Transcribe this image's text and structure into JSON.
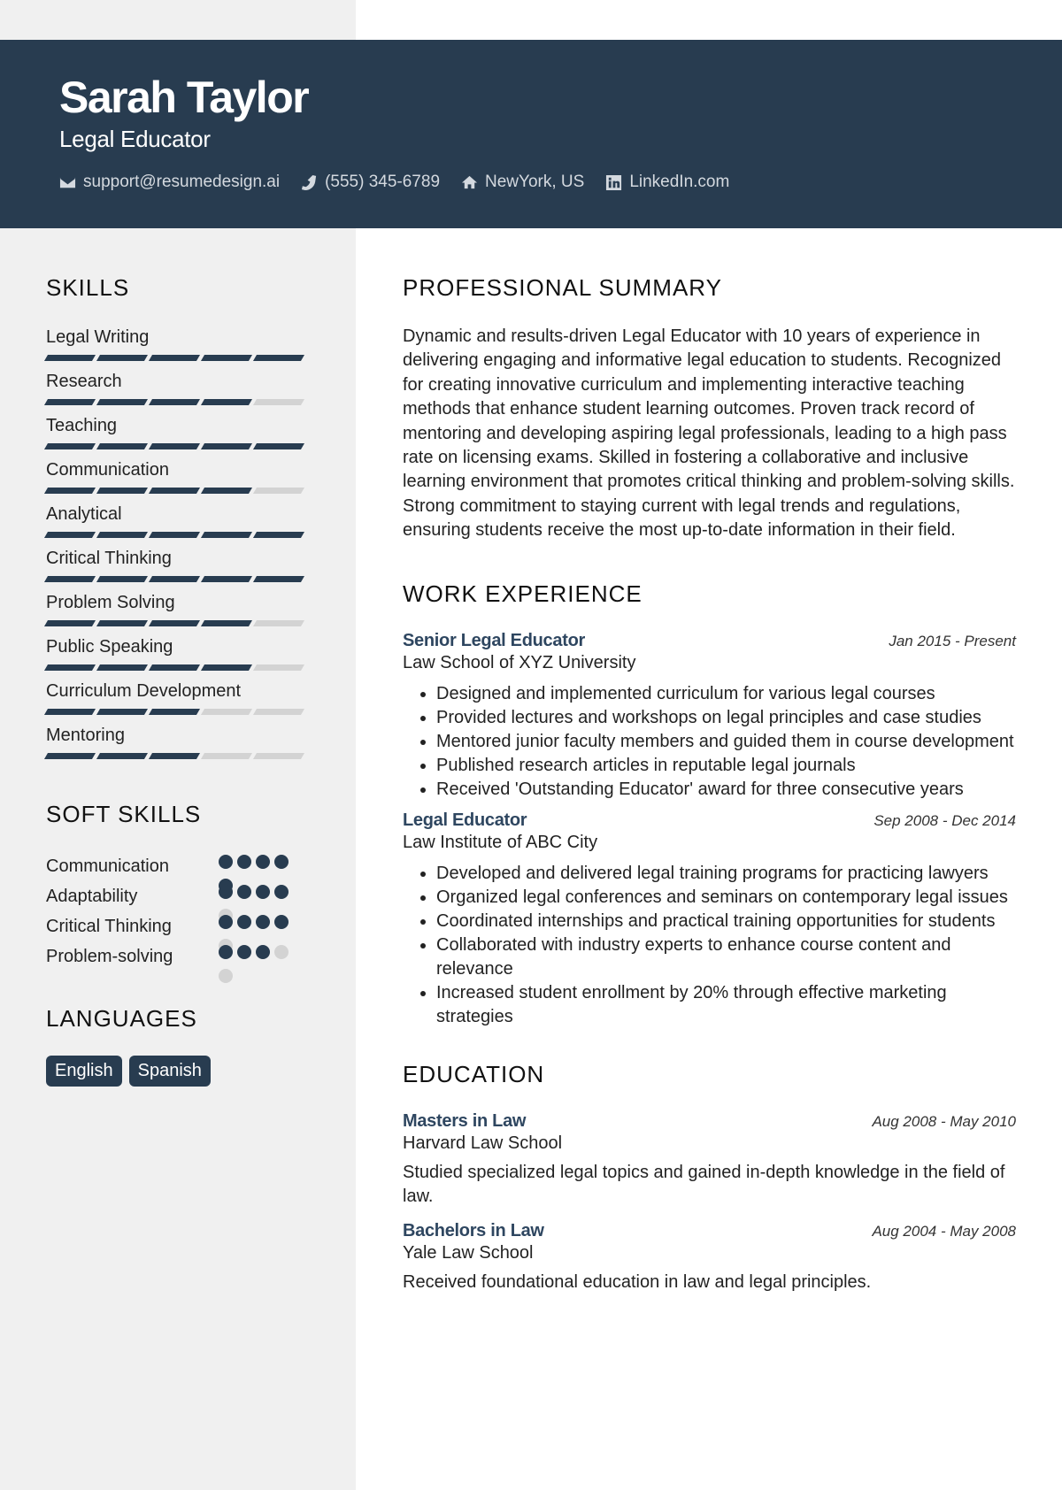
{
  "header": {
    "name": "Sarah Taylor",
    "role": "Legal Educator",
    "contacts": [
      {
        "icon": "envelope-icon",
        "text": "support@resumedesign.ai"
      },
      {
        "icon": "phone-icon",
        "text": "(555) 345-6789"
      },
      {
        "icon": "home-icon",
        "text": "NewYork, US"
      },
      {
        "icon": "linkedin-icon",
        "text": "LinkedIn.com"
      }
    ]
  },
  "colors": {
    "accent": "#283c50",
    "sidebar_bg": "#f0f0f0",
    "inactive": "#d3d3d3"
  },
  "sidebar": {
    "skills_heading": "SKILLS",
    "skills": [
      {
        "name": "Legal Writing",
        "level": 5,
        "max": 5
      },
      {
        "name": "Research",
        "level": 4,
        "max": 5
      },
      {
        "name": "Teaching",
        "level": 5,
        "max": 5
      },
      {
        "name": "Communication",
        "level": 4,
        "max": 5
      },
      {
        "name": "Analytical",
        "level": 5,
        "max": 5
      },
      {
        "name": "Critical Thinking",
        "level": 5,
        "max": 5
      },
      {
        "name": "Problem Solving",
        "level": 4,
        "max": 5
      },
      {
        "name": "Public Speaking",
        "level": 4,
        "max": 5
      },
      {
        "name": "Curriculum Development",
        "level": 3,
        "max": 5
      },
      {
        "name": "Mentoring",
        "level": 3,
        "max": 5
      }
    ],
    "soft_skills_heading": "SOFT SKILLS",
    "soft_skills": [
      {
        "name": "Communication",
        "level": 5,
        "max": 5
      },
      {
        "name": "Adaptability",
        "level": 4,
        "max": 5
      },
      {
        "name": "Critical Thinking",
        "level": 4,
        "max": 5
      },
      {
        "name": "Problem-solving",
        "level": 3,
        "max": 5
      }
    ],
    "languages_heading": "LANGUAGES",
    "languages": [
      "English",
      "Spanish"
    ]
  },
  "main": {
    "summary_heading": "PROFESSIONAL SUMMARY",
    "summary": "Dynamic and results-driven Legal Educator with 10 years of experience in delivering engaging and informative legal education to students. Recognized for creating innovative curriculum and implementing interactive teaching methods that enhance student learning outcomes. Proven track record of mentoring and developing aspiring legal professionals, leading to a high pass rate on licensing exams. Skilled in fostering a collaborative and inclusive learning environment that promotes critical thinking and problem-solving skills. Strong commitment to staying current with legal trends and regulations, ensuring students receive the most up-to-date information in their field.",
    "experience_heading": "WORK EXPERIENCE",
    "experience": [
      {
        "title": "Senior Legal Educator",
        "date": "Jan 2015 - Present",
        "org": "Law School of XYZ University",
        "bullets": [
          "Designed and implemented curriculum for various legal courses",
          "Provided lectures and workshops on legal principles and case studies",
          "Mentored junior faculty members and guided them in course development",
          "Published research articles in reputable legal journals",
          "Received 'Outstanding Educator' award for three consecutive years"
        ]
      },
      {
        "title": "Legal Educator",
        "date": "Sep 2008 - Dec 2014",
        "org": "Law Institute of ABC City",
        "bullets": [
          "Developed and delivered legal training programs for practicing lawyers",
          "Organized legal conferences and seminars on contemporary legal issues",
          "Coordinated internships and practical training opportunities for students",
          "Collaborated with industry experts to enhance course content and relevance",
          "Increased student enrollment by 20% through effective marketing strategies"
        ]
      }
    ],
    "education_heading": "EDUCATION",
    "education": [
      {
        "degree": "Masters in Law",
        "date": "Aug 2008 - May 2010",
        "school": "Harvard Law School",
        "desc": "Studied specialized legal topics and gained in-depth knowledge in the field of law."
      },
      {
        "degree": "Bachelors in Law",
        "date": "Aug 2004 - May 2008",
        "school": "Yale Law School",
        "desc": "Received foundational education in law and legal principles."
      }
    ]
  }
}
